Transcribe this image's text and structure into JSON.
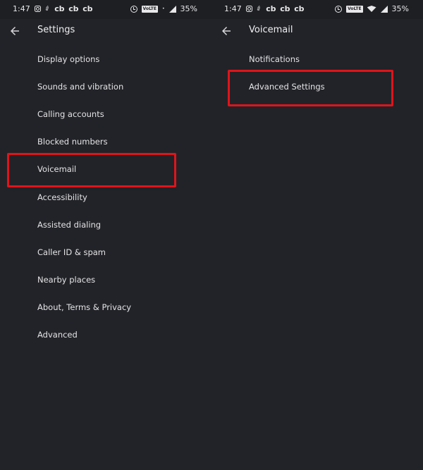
{
  "screens": [
    {
      "status_bar": {
        "time": "1:47",
        "notification_icons": [
          "instagram-icon",
          "tag-icon"
        ],
        "notification_labels": [
          "cb",
          "cb",
          "cb"
        ],
        "right_icons": [
          "alarm-icon",
          "volte-badge",
          "signal-icon"
        ],
        "volte_label": "VoLTE",
        "battery": "35%"
      },
      "toolbar": {
        "back_icon": "arrow-left-icon",
        "title": "Settings"
      },
      "items": [
        {
          "label": "Display options"
        },
        {
          "label": "Sounds and vibration"
        },
        {
          "label": "Calling accounts"
        },
        {
          "label": "Blocked numbers"
        },
        {
          "label": "Voicemail",
          "highlighted": true
        },
        {
          "label": "Accessibility"
        },
        {
          "label": "Assisted dialing"
        },
        {
          "label": "Caller ID & spam"
        },
        {
          "label": "Nearby places"
        },
        {
          "label": "About, Terms & Privacy"
        },
        {
          "label": "Advanced"
        }
      ]
    },
    {
      "status_bar": {
        "time": "1:47",
        "notification_icons": [
          "instagram-icon",
          "tag-icon"
        ],
        "notification_labels": [
          "cb",
          "cb",
          "cb"
        ],
        "right_icons": [
          "alarm-icon",
          "volte-badge",
          "wifi-icon",
          "signal-icon"
        ],
        "volte_label": "VoLTE",
        "battery": "35%"
      },
      "toolbar": {
        "back_icon": "arrow-left-icon",
        "title": "Voicemail"
      },
      "items": [
        {
          "label": "Notifications"
        },
        {
          "label": "Advanced Settings",
          "highlighted": true
        }
      ]
    }
  ],
  "colors": {
    "background": "#222328",
    "status_bar": "#1e1f23",
    "text": "#e4e4e6",
    "highlight": "#e0141b"
  }
}
